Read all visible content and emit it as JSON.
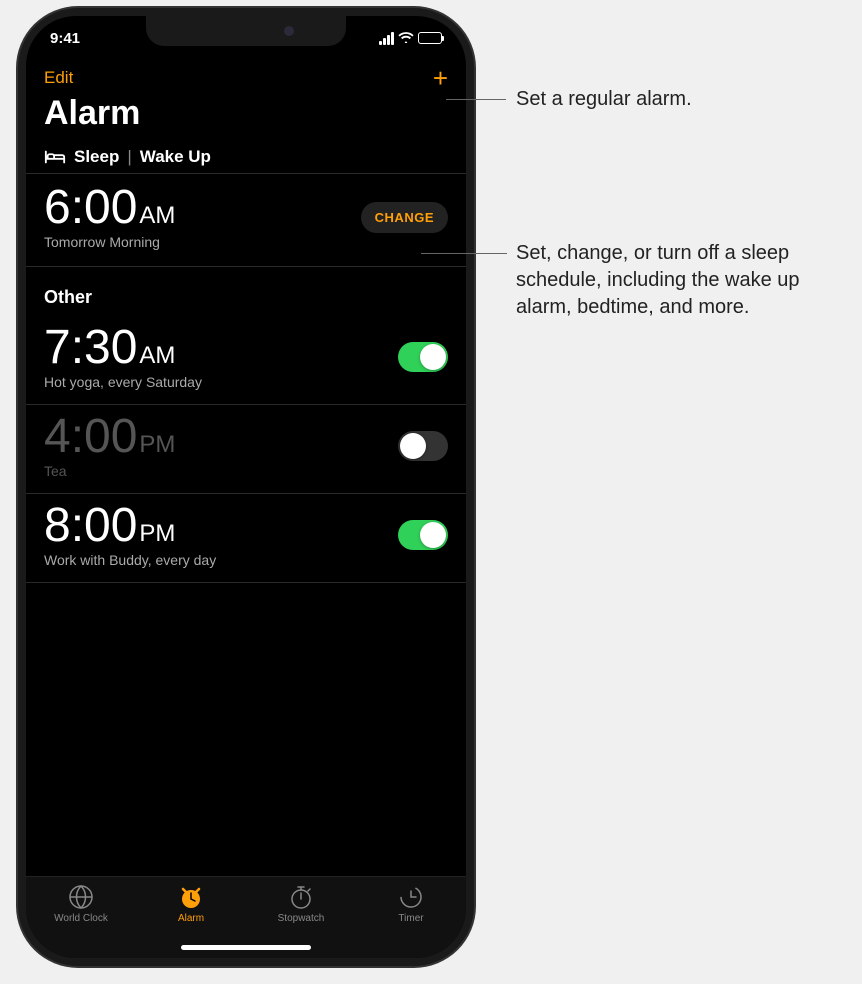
{
  "status": {
    "time": "9:41"
  },
  "nav": {
    "edit": "Edit"
  },
  "title": "Alarm",
  "sleep_section": {
    "label_sleep": "Sleep",
    "label_wake": "Wake Up",
    "time": "6:00",
    "ampm": "AM",
    "subtitle": "Tomorrow Morning",
    "change": "CHANGE"
  },
  "other_header": "Other",
  "alarms": [
    {
      "time": "7:30",
      "ampm": "AM",
      "label": "Hot yoga, every Saturday",
      "on": true
    },
    {
      "time": "4:00",
      "ampm": "PM",
      "label": "Tea",
      "on": false
    },
    {
      "time": "8:00",
      "ampm": "PM",
      "label": "Work with Buddy, every day",
      "on": true
    }
  ],
  "tabs": [
    {
      "label": "World Clock",
      "active": false
    },
    {
      "label": "Alarm",
      "active": true
    },
    {
      "label": "Stopwatch",
      "active": false
    },
    {
      "label": "Timer",
      "active": false
    }
  ],
  "callouts": {
    "add": "Set a regular alarm.",
    "change": "Set, change, or turn off a sleep schedule, including the wake up alarm, bedtime, and more."
  },
  "colors": {
    "accent": "#ff9f0a",
    "toggle_on": "#30d158"
  }
}
